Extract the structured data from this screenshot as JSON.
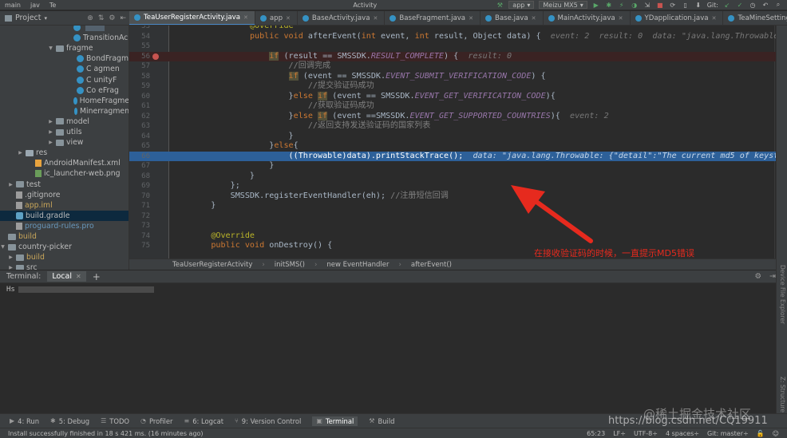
{
  "topbar": {
    "crumbs": [
      "main",
      "jav",
      "Te",
      "Activity"
    ],
    "run_config": "app",
    "device": "Meizu MX5",
    "vcs_label": "Git:"
  },
  "project_panel": {
    "title": "Project",
    "tree": [
      {
        "label": "",
        "type": "class",
        "indent": 92,
        "blur": true
      },
      {
        "label": "TransitionAc",
        "type": "class",
        "indent": 92
      },
      {
        "label": "fragme",
        "type": "folder",
        "indent": 70,
        "arrow": "▼"
      },
      {
        "label": "BondFragm",
        "type": "class",
        "indent": 96
      },
      {
        "label": "C    agmen",
        "type": "class",
        "indent": 96
      },
      {
        "label": "C          unityF",
        "type": "class",
        "indent": 96
      },
      {
        "label": "Co        eFrag",
        "type": "class",
        "indent": 96
      },
      {
        "label": "HomeFragme",
        "type": "class",
        "indent": 96
      },
      {
        "label": "Minerragmen",
        "type": "class",
        "indent": 96
      },
      {
        "label": "model",
        "type": "folder",
        "indent": 70,
        "arrow": "▶"
      },
      {
        "label": "utils",
        "type": "folder",
        "indent": 70,
        "arrow": "▶"
      },
      {
        "label": "view",
        "type": "folder",
        "indent": 70,
        "arrow": "▶"
      },
      {
        "label": "res",
        "type": "res",
        "indent": 32,
        "arrow": "▶"
      },
      {
        "label": "AndroidManifest.xml",
        "type": "xml",
        "indent": 44
      },
      {
        "label": "ic_launcher-web.png",
        "type": "img",
        "indent": 44
      },
      {
        "label": "test",
        "type": "folder",
        "indent": 20,
        "arrow": "▶"
      },
      {
        "label": ".gitignore",
        "type": "file",
        "indent": 20
      },
      {
        "label": "app.iml",
        "type": "file",
        "indent": 20,
        "orange": true
      },
      {
        "label": "build.gradle",
        "type": "gradle",
        "indent": 20,
        "selected": true
      },
      {
        "label": "proguard-rules.pro",
        "type": "file",
        "indent": 20,
        "blueish": true
      },
      {
        "label": "build",
        "type": "folder",
        "indent": 8,
        "orange": true
      },
      {
        "label": "country-picker",
        "type": "folder",
        "indent": 8,
        "arrow": "▼"
      },
      {
        "label": "build",
        "type": "folder",
        "indent": 20,
        "arrow": "▶",
        "orange": true
      },
      {
        "label": "src",
        "type": "folder",
        "indent": 20,
        "arrow": "▶"
      }
    ]
  },
  "tabs": [
    {
      "label": "TeaUserRegisterActivity.java",
      "active": true
    },
    {
      "label": "app"
    },
    {
      "label": "BaseActivity.java"
    },
    {
      "label": "BaseFragment.java"
    },
    {
      "label": "Base.java"
    },
    {
      "label": "MainActivity.java"
    },
    {
      "label": "YDapplication.java"
    },
    {
      "label": "TeaMineSettingActivity.java"
    }
  ],
  "code_lines": [
    {
      "n": "53",
      "code": "            @Override"
    },
    {
      "n": "54",
      "code": "            public void afterEvent(int event, int result, Object data) {  event: 2  result: 0  data: \"java.lang.Throwable: {\""
    },
    {
      "n": "55",
      "code": ""
    },
    {
      "n": "56",
      "code": "                if (result == SMSSDK.RESULT_COMPLETE) {  result: 0",
      "bp": true
    },
    {
      "n": "57",
      "code": "                    //回调完成"
    },
    {
      "n": "58",
      "code": "                    if (event == SMSSDK.EVENT_SUBMIT_VERIFICATION_CODE) {"
    },
    {
      "n": "59",
      "code": "                        //提交验证码成功"
    },
    {
      "n": "60",
      "code": "                    }else if (event == SMSSDK.EVENT_GET_VERIFICATION_CODE){"
    },
    {
      "n": "61",
      "code": "                        //获取验证码成功"
    },
    {
      "n": "62",
      "code": "                    }else if (event ==SMSSDK.EVENT_GET_SUPPORTED_COUNTRIES){  event: 2"
    },
    {
      "n": "63",
      "code": "                        //返回支持发送验证码的国家列表"
    },
    {
      "n": "64",
      "code": "                    }"
    },
    {
      "n": "65",
      "code": "                }else{"
    },
    {
      "n": "66",
      "code": "                    ((Throwable)data).printStackTrace();  data: \"java.lang.Throwable: {\"detail\":\"The current md5 of keysto",
      "exec": true
    },
    {
      "n": "67",
      "code": "                }"
    },
    {
      "n": "68",
      "code": "            }"
    },
    {
      "n": "69",
      "code": "        };"
    },
    {
      "n": "70",
      "code": "        SMSSDK.registerEventHandler(eh); //注册短信回调"
    },
    {
      "n": "71",
      "code": "    }"
    },
    {
      "n": "72",
      "code": ""
    },
    {
      "n": "73",
      "code": ""
    },
    {
      "n": "74",
      "code": "    @Override"
    },
    {
      "n": "75",
      "code": "    public void onDestroy() {"
    }
  ],
  "breadcrumb": [
    "TeaUserRegisterActivity",
    "initSMS()",
    "new EventHandler",
    "afterEvent()"
  ],
  "annotation": {
    "text": "在接收验证码的时候，一直提示MD5错误",
    "color": "#e62a1e"
  },
  "terminal": {
    "title": "Terminal:",
    "tab": "Local",
    "add": "+",
    "prompt": "Hs"
  },
  "tool_tabs": [
    {
      "label": "4: Run",
      "icon": "▶"
    },
    {
      "label": "5: Debug",
      "icon": "✱"
    },
    {
      "label": "TODO",
      "icon": "☰"
    },
    {
      "label": "Profiler",
      "icon": "◔"
    },
    {
      "label": "6: Logcat",
      "icon": "≡"
    },
    {
      "label": "9: Version Control",
      "icon": "⑂"
    },
    {
      "label": "Terminal",
      "icon": "▣",
      "active": true
    },
    {
      "label": "Build",
      "icon": "⚒"
    }
  ],
  "status": {
    "message": "Install successfully finished in 18 s 421 ms. (16 minutes ago)",
    "position": "65:23",
    "line_sep": "LF÷",
    "encoding": "UTF-8÷",
    "indent": "4 spaces÷",
    "branch": "Git: master÷"
  },
  "watermark": {
    "cn": "@稀土掘金技术社区",
    "url": "https://blog.csdn.net/CQ19911"
  },
  "right_strip": [
    "Device File Explorer",
    "Z: Structure"
  ]
}
